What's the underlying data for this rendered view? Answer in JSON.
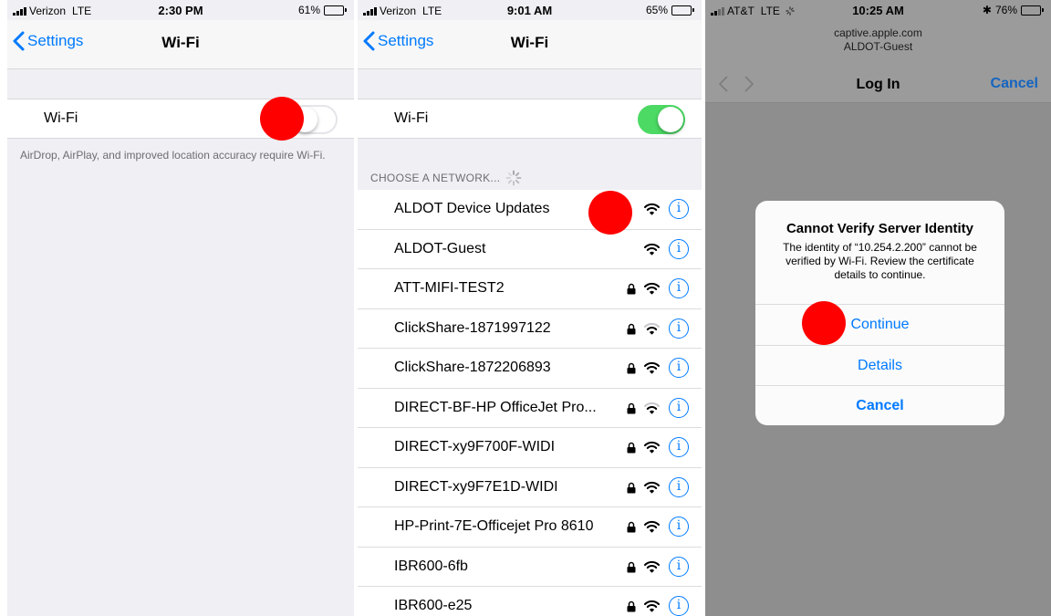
{
  "colors": {
    "accent_blue": "#007aff",
    "toggle_on_green": "#4cd964",
    "tap_marker_red": "#ff0000",
    "group_background": "#efeff4",
    "dimmed_background": "#8e8e8e"
  },
  "panel1": {
    "status": {
      "carrier": "Verizon",
      "network": "LTE",
      "time": "2:30 PM",
      "battery": "61%",
      "battery_level": 0.61
    },
    "nav": {
      "back_label": "Settings",
      "title": "Wi-Fi"
    },
    "wifi_row": {
      "label": "Wi-Fi",
      "enabled": false
    },
    "hint": "AirDrop, AirPlay, and improved location accuracy require Wi-Fi."
  },
  "panel2": {
    "status": {
      "carrier": "Verizon",
      "network": "LTE",
      "time": "9:01 AM",
      "battery": "65%",
      "battery_level": 0.65
    },
    "nav": {
      "back_label": "Settings",
      "title": "Wi-Fi"
    },
    "wifi_row": {
      "label": "Wi-Fi",
      "enabled": true
    },
    "section_header": "CHOOSE A NETWORK...",
    "networks": [
      {
        "name": "ALDOT Device Updates",
        "locked": false,
        "signal": "full"
      },
      {
        "name": "ALDOT-Guest",
        "locked": false,
        "signal": "full"
      },
      {
        "name": "ATT-MIFI-TEST2",
        "locked": true,
        "signal": "full"
      },
      {
        "name": "ClickShare-1871997122",
        "locked": true,
        "signal": "weak"
      },
      {
        "name": "ClickShare-1872206893",
        "locked": true,
        "signal": "full"
      },
      {
        "name": "DIRECT-BF-HP OfficeJet Pro...",
        "locked": true,
        "signal": "weak"
      },
      {
        "name": "DIRECT-xy9F700F-WIDI",
        "locked": true,
        "signal": "full"
      },
      {
        "name": "DIRECT-xy9F7E1D-WIDI",
        "locked": true,
        "signal": "full"
      },
      {
        "name": "HP-Print-7E-Officejet Pro 8610",
        "locked": true,
        "signal": "full"
      },
      {
        "name": "IBR600-6fb",
        "locked": true,
        "signal": "full"
      },
      {
        "name": "IBR600-e25",
        "locked": true,
        "signal": "full"
      }
    ],
    "info_glyph": "i"
  },
  "panel3": {
    "status": {
      "carrier": "AT&T",
      "network": "LTE",
      "time": "10:25 AM",
      "battery": "76%",
      "battery_level": 0.76
    },
    "url_host": "captive.apple.com",
    "url_ssid": "ALDOT-Guest",
    "nav": {
      "title": "Log In",
      "cancel": "Cancel"
    },
    "alert": {
      "title": "Cannot Verify Server Identity",
      "message": "The identity of “10.254.2.200” cannot be verified by Wi-Fi. Review the certificate details to continue.",
      "buttons": {
        "continue": "Continue",
        "details": "Details",
        "cancel": "Cancel"
      }
    }
  }
}
